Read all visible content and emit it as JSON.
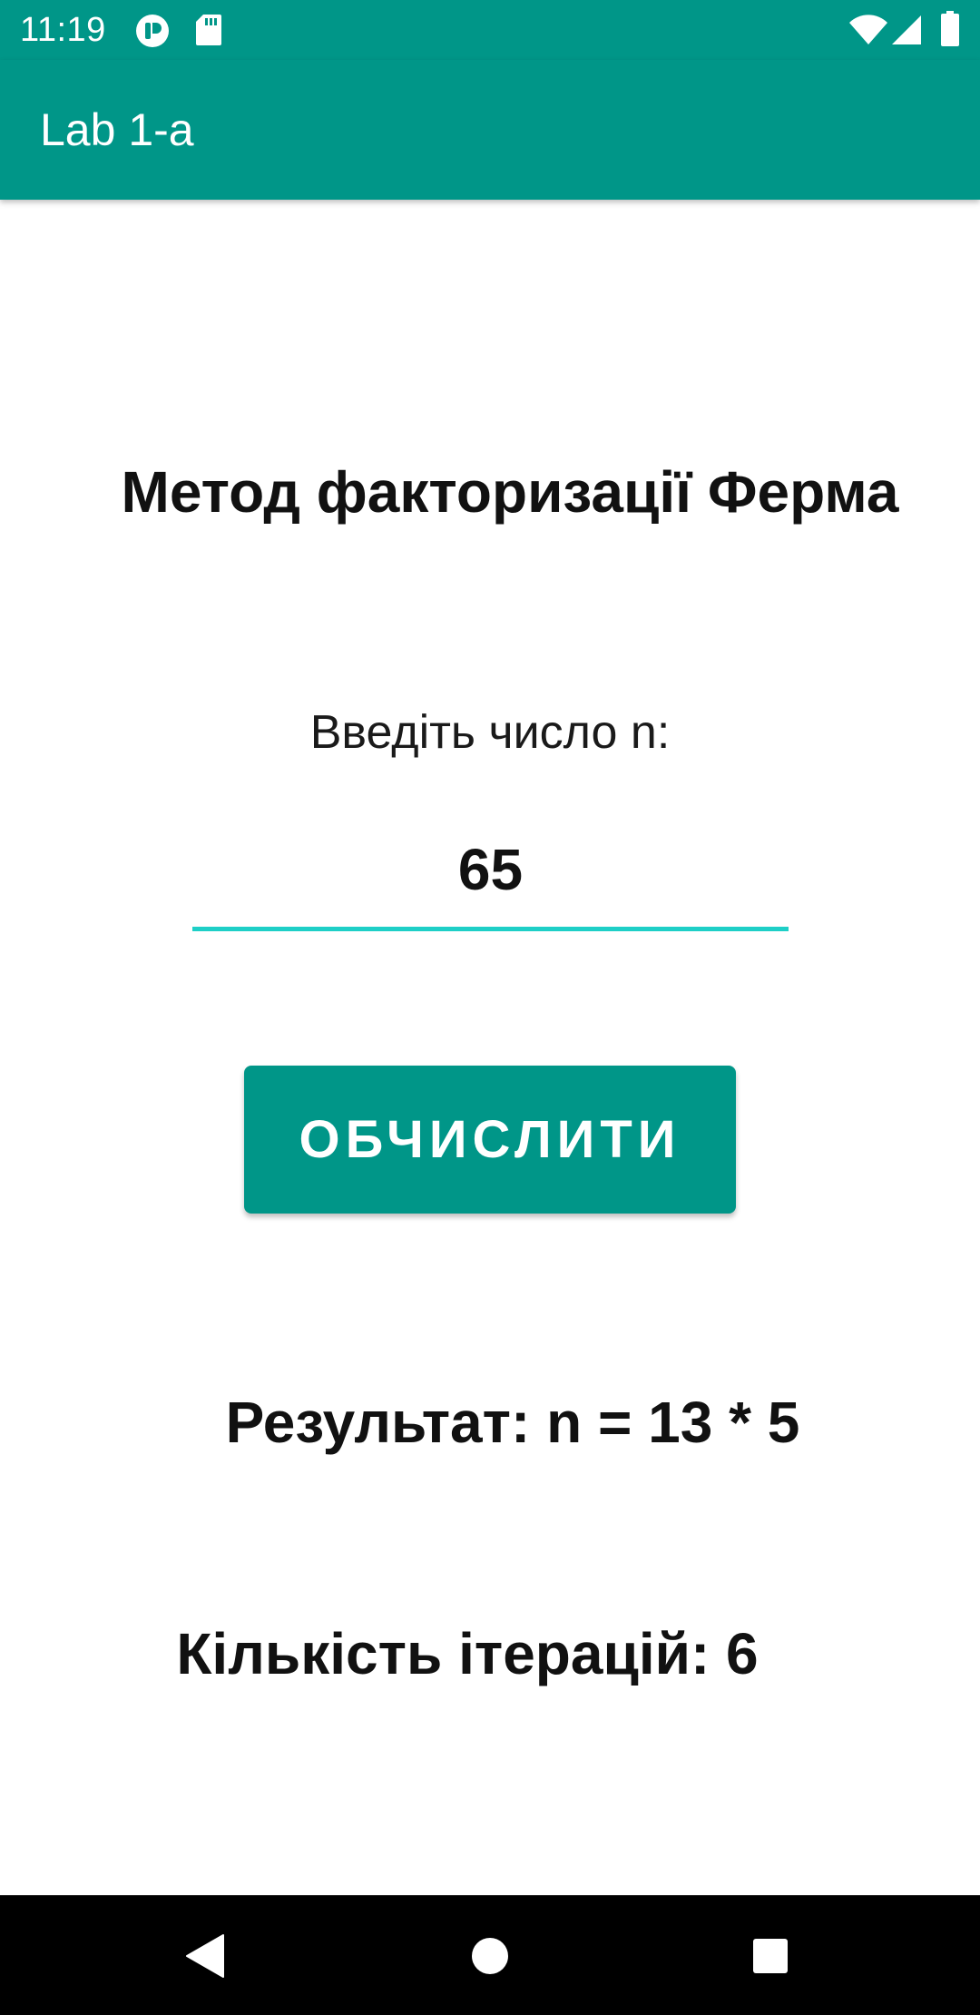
{
  "status_bar": {
    "time": "11:19",
    "left_icons": [
      "app-notification-icon",
      "sd-card-icon"
    ],
    "right_icons": [
      "wifi-icon",
      "cell-signal-icon",
      "battery-icon"
    ]
  },
  "app_bar": {
    "title": "Lab 1-a"
  },
  "main": {
    "heading": "Метод факторизації Ферма",
    "input_prompt": "Введіть число n:",
    "input_value": "65",
    "button_label": "ОБЧИСЛИТИ",
    "result_text": "Результат: n = 13 * 5",
    "iterations_text": "Кількість ітерацій: 6"
  },
  "nav_bar": {
    "buttons": [
      "back-icon",
      "home-icon",
      "recents-icon"
    ]
  },
  "colors": {
    "primary": "#009688",
    "accent": "#1ECFC7",
    "nav_bar": "#000000",
    "background": "#FFFFFF"
  }
}
